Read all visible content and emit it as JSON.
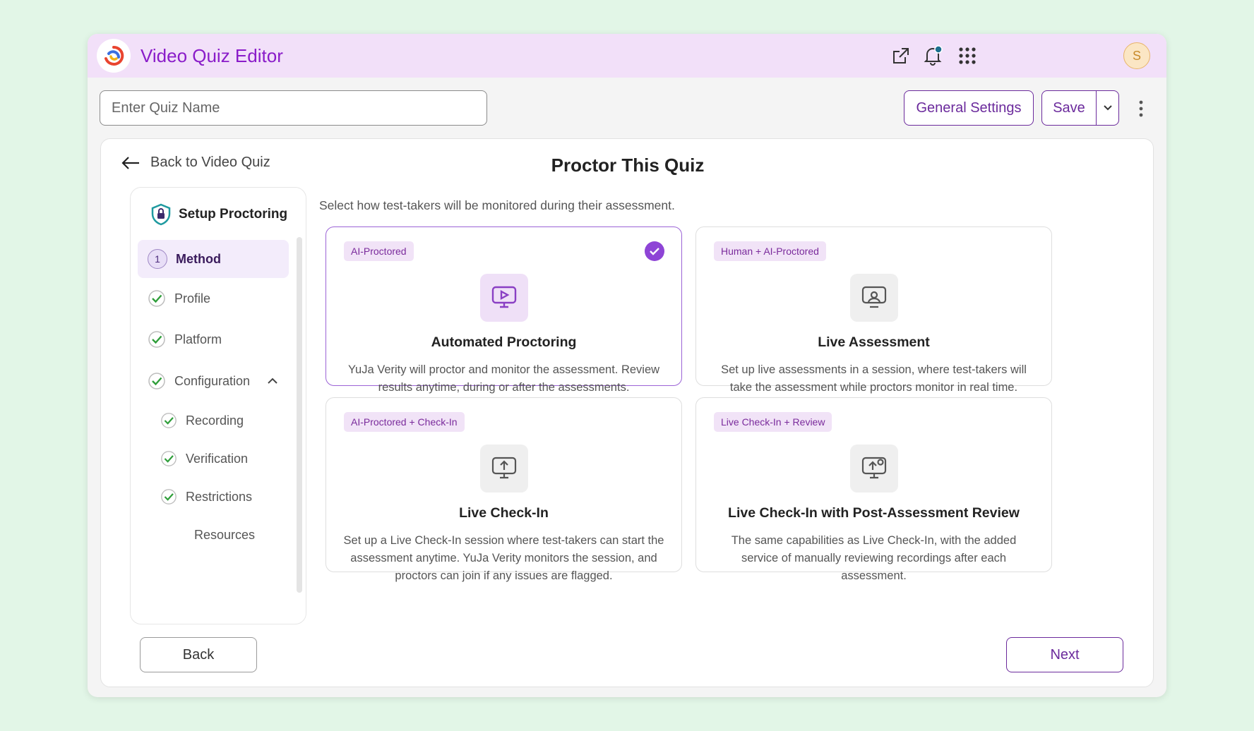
{
  "header": {
    "title": "Video Quiz Editor",
    "avatar_initial": "S",
    "icons": [
      "external-link-icon",
      "bell-icon",
      "apps-grid-icon"
    ],
    "brand_color": "#8a1cc9"
  },
  "toolbar": {
    "quiz_name_placeholder": "Enter Quiz Name",
    "general_settings_label": "General Settings",
    "save_label": "Save"
  },
  "panel": {
    "back_link": "Back to Video Quiz",
    "title": "Proctor This Quiz",
    "hint": "Select how test-takers will be monitored during their assessment."
  },
  "steps": {
    "heading": "Setup Proctoring",
    "items": [
      {
        "number": "1",
        "label": "Method",
        "state": "active"
      },
      {
        "label": "Profile",
        "state": "done"
      },
      {
        "label": "Platform",
        "state": "done"
      },
      {
        "label": "Configuration",
        "state": "done",
        "expanded": true
      },
      {
        "label": "Recording",
        "state": "done"
      },
      {
        "label": "Verification",
        "state": "done"
      },
      {
        "label": "Restrictions",
        "state": "done"
      },
      {
        "label": "Resources",
        "state": "pending"
      }
    ]
  },
  "methods": [
    {
      "badge": "AI-Proctored",
      "title": "Automated Proctoring",
      "description": "YuJa Verity will proctor and monitor the assessment. Review results anytime, during or after the assessments.",
      "selected": true,
      "icon": "monitor-play-icon"
    },
    {
      "badge": "Human + AI-Proctored",
      "title": "Live Assessment",
      "description": "Set up live assessments in a session, where test-takers will take the assessment while proctors monitor in real time.",
      "selected": false,
      "icon": "monitor-person-icon"
    },
    {
      "badge": "AI-Proctored + Check-In",
      "title": "Live Check-In",
      "description": "Set up a Live Check-In session where test-takers can start the assessment anytime. YuJa Verity monitors the session, and proctors can join if any issues are flagged.",
      "selected": false,
      "icon": "monitor-upload-icon"
    },
    {
      "badge": "Live Check-In + Review",
      "title": "Live Check-In with Post-Assessment Review",
      "description": "The same capabilities as Live Check-In, with the added service of manually reviewing recordings after each assessment.",
      "selected": false,
      "icon": "monitor-upload-review-icon"
    }
  ],
  "footer": {
    "back_label": "Back",
    "next_label": "Next"
  }
}
